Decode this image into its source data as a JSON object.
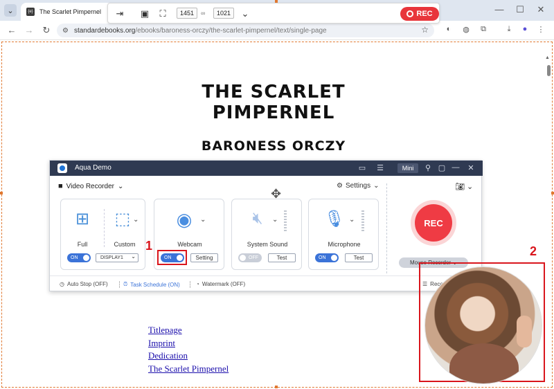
{
  "browser": {
    "tab_title": "The Scarlet Pimpernel",
    "favicon_text": "{e}",
    "url_host": "standardebooks.org",
    "url_path": "/ebooks/baroness-orczy/the-scarlet-pimpernel/text/single-page"
  },
  "recorder_toolbar": {
    "width_value": "1451",
    "height_value": "1021",
    "rec_label": "REC"
  },
  "page": {
    "title_line1": "THE SCARLET",
    "title_line2": "PIMPERNEL",
    "author": "BARONESS ORCZY",
    "toc": [
      "Titlepage",
      "Imprint",
      "Dedication",
      "The Scarlet Pimpernel"
    ]
  },
  "aqua": {
    "title": "Aqua Demo",
    "mini_label": "Mini",
    "mode_label": "Video Recorder",
    "settings_label": "Settings",
    "display": {
      "full_label": "Full",
      "custom_label": "Custom",
      "toggle": "ON",
      "select_value": "DISPLAY1"
    },
    "webcam": {
      "label": "Webcam",
      "toggle": "ON",
      "setting_label": "Setting"
    },
    "system_sound": {
      "label": "System Sound",
      "toggle": "OFF",
      "test_label": "Test"
    },
    "microphone": {
      "label": "Microphone",
      "toggle": "ON",
      "test_label": "Test"
    },
    "rec_label": "REC",
    "mouse_recorder_label": "Mouse Recorder",
    "footer": {
      "auto_stop": "Auto Stop (OFF)",
      "task_schedule": "Task Schedule (ON)",
      "watermark": "Watermark (OFF)",
      "recording_history": "Reco"
    }
  },
  "annotations": {
    "label_1": "1",
    "label_2": "2"
  },
  "colors": {
    "accent_blue": "#3b73d8",
    "rec_red": "#ef3b44",
    "annotation_red": "#d9151c",
    "titlebar": "#2f3a52"
  }
}
